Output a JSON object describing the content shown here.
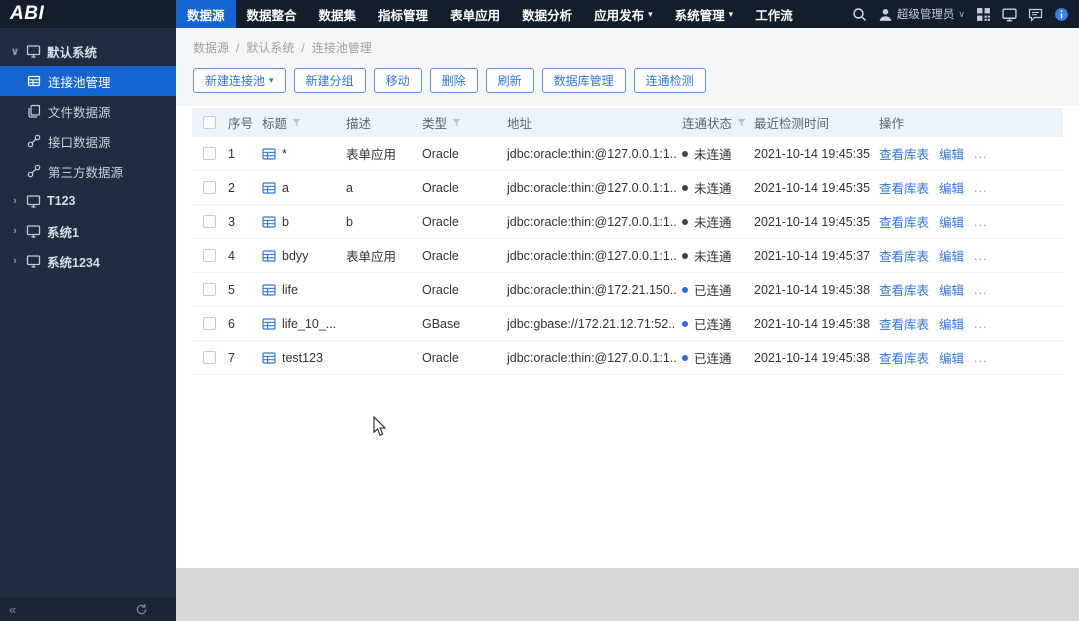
{
  "colors": {
    "accent": "#1565d1",
    "link": "#3277da",
    "topbar_bg": "#141d2b",
    "sidebar_bg": "#202c3f",
    "table_header_bg": "#edf3fa",
    "status_connected": "#2e6cd9",
    "status_disconnected": "#3c4350"
  },
  "glyphs": {
    "caret_down": "▾",
    "chevron_down": "∨",
    "chevron_right": "›",
    "user_chevron": "∨",
    "collapse": "«",
    "separator": "/"
  },
  "topbar": {
    "logo": "ABI",
    "nav": [
      {
        "label": "数据源",
        "active": true
      },
      {
        "label": "数据整合"
      },
      {
        "label": "数据集"
      },
      {
        "label": "指标管理"
      },
      {
        "label": "表单应用"
      },
      {
        "label": "数据分析"
      },
      {
        "label": "应用发布",
        "caret": true
      },
      {
        "label": "系统管理",
        "caret": true
      },
      {
        "label": "工作流"
      }
    ],
    "user_name": "超级管理员"
  },
  "sidebar": {
    "tree": [
      {
        "label": "默认系统",
        "expanded": true,
        "children": [
          {
            "label": "连接池管理",
            "icon": "table",
            "selected": true
          },
          {
            "label": "文件数据源",
            "icon": "file"
          },
          {
            "label": "接口数据源",
            "icon": "plug"
          },
          {
            "label": "第三方数据源",
            "icon": "plug"
          }
        ]
      },
      {
        "label": "T123",
        "expanded": false
      },
      {
        "label": "系统1",
        "expanded": false
      },
      {
        "label": "系统1234",
        "expanded": false
      }
    ]
  },
  "breadcrumb": {
    "items": [
      "数据源",
      "默认系统",
      "连接池管理"
    ]
  },
  "toolbar": {
    "buttons": [
      {
        "label": "新建连接池",
        "caret": true
      },
      {
        "label": "新建分组"
      },
      {
        "label": "移动"
      },
      {
        "label": "删除"
      },
      {
        "label": "刷新"
      },
      {
        "label": "数据库管理"
      },
      {
        "label": "连通检测"
      }
    ]
  },
  "table": {
    "headers": {
      "index": "序号",
      "title": "标题",
      "description": "描述",
      "type": "类型",
      "address": "地址",
      "status": "连通状态",
      "checked_time": "最近检测时间",
      "operations": "操作"
    },
    "ops": {
      "view": "查看库表",
      "edit": "编辑",
      "more": "..."
    },
    "status_colors": {
      "connected": "#2e6cd9",
      "disconnected": "#3c4350"
    },
    "rows": [
      {
        "index": "1",
        "title": "*",
        "description": "表单应用",
        "type": "Oracle",
        "address": "jdbc:oracle:thin:@127.0.0.1:1...",
        "status": "未连通",
        "connected": false,
        "checked_time": "2021-10-14 19:45:35"
      },
      {
        "index": "2",
        "title": "a",
        "description": "a",
        "type": "Oracle",
        "address": "jdbc:oracle:thin:@127.0.0.1:1...",
        "status": "未连通",
        "connected": false,
        "checked_time": "2021-10-14 19:45:35"
      },
      {
        "index": "3",
        "title": "b",
        "description": "b",
        "type": "Oracle",
        "address": "jdbc:oracle:thin:@127.0.0.1:1...",
        "status": "未连通",
        "connected": false,
        "checked_time": "2021-10-14 19:45:35"
      },
      {
        "index": "4",
        "title": "bdyy",
        "description": "表单应用",
        "type": "Oracle",
        "address": "jdbc:oracle:thin:@127.0.0.1:1...",
        "status": "未连通",
        "connected": false,
        "checked_time": "2021-10-14 19:45:37"
      },
      {
        "index": "5",
        "title": "life",
        "description": "",
        "type": "Oracle",
        "address": "jdbc:oracle:thin:@172.21.150...",
        "status": "已连通",
        "connected": true,
        "checked_time": "2021-10-14 19:45:38"
      },
      {
        "index": "6",
        "title": "life_10_...",
        "description": "",
        "type": "GBase",
        "address": "jdbc:gbase://172.21.12.71:52...",
        "status": "已连通",
        "connected": true,
        "checked_time": "2021-10-14 19:45:38"
      },
      {
        "index": "7",
        "title": "test123",
        "description": "",
        "type": "Oracle",
        "address": "jdbc:oracle:thin:@127.0.0.1:1...",
        "status": "已连通",
        "connected": true,
        "checked_time": "2021-10-14 19:45:38"
      }
    ]
  }
}
